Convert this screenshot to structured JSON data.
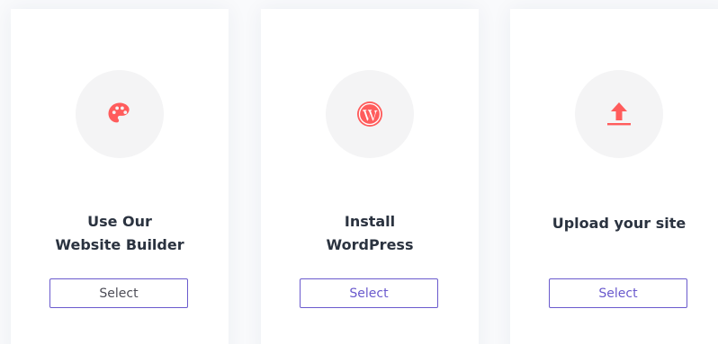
{
  "accent_color": "#ff5c5c",
  "button_border_color": "#6a5acd",
  "cards": [
    {
      "icon": "palette-icon",
      "title_lines": [
        "Use Our",
        "Website Builder"
      ],
      "button_label": "Select"
    },
    {
      "icon": "wordpress-icon",
      "title_lines": [
        "Install",
        "WordPress"
      ],
      "button_label": "Select"
    },
    {
      "icon": "upload-icon",
      "title_lines": [
        "Upload your site"
      ],
      "button_label": "Select"
    }
  ]
}
